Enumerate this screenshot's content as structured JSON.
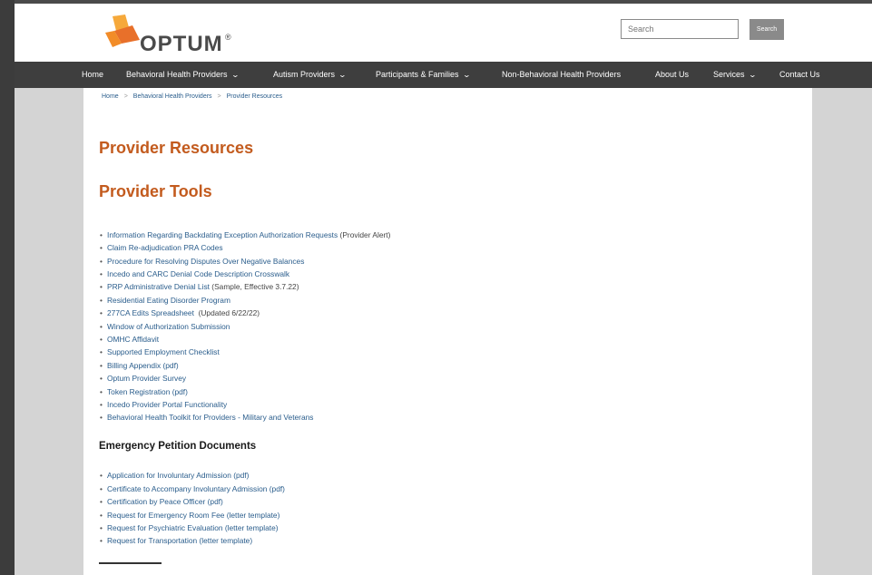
{
  "header": {
    "logo_text": "OPTUM",
    "logo_reg": "®",
    "search_placeholder": "Search",
    "search_button": "Search",
    "colors": {
      "logo_orange": "#F28C28",
      "logo_dark": "#4a4a4a"
    }
  },
  "nav": {
    "items": [
      {
        "label": "Home",
        "dropdown": false
      },
      {
        "label": "Behavioral Health Providers",
        "dropdown": true
      },
      {
        "label": "Autism Providers",
        "dropdown": true
      },
      {
        "label": "Participants & Families",
        "dropdown": true
      },
      {
        "label": "Non-Behavioral Health Providers",
        "dropdown": false
      },
      {
        "label": "About Us",
        "dropdown": false
      },
      {
        "label": "Services",
        "dropdown": true
      },
      {
        "label": "Contact Us",
        "dropdown": false
      }
    ]
  },
  "breadcrumb": [
    "Home",
    "Behavioral Health Providers",
    "Provider Resources"
  ],
  "page_title": "Provider Resources",
  "section_title": "Provider Tools",
  "tools": [
    {
      "link": "Information Regarding Backdating Exception Authorization Requests",
      "suffix": " (Provider Alert)"
    },
    {
      "link": "Claim Re-adjudication PRA Codes",
      "suffix": ""
    },
    {
      "link": "Procedure for Resolving Disputes Over Negative Balances",
      "suffix": ""
    },
    {
      "link": "Incedo and CARC Denial Code Description Crosswalk",
      "suffix": ""
    },
    {
      "link": "PRP Administrative Denial List",
      "suffix": " (Sample, Effective 3.7.22)"
    },
    {
      "link": "Residential Eating Disorder Program",
      "suffix": ""
    },
    {
      "link": "277CA Edits Spreadsheet",
      "suffix": "  (Updated 6/22/22)"
    },
    {
      "link": "Window of Authorization Submission",
      "suffix": ""
    },
    {
      "link": "OMHC Affidavit",
      "suffix": ""
    },
    {
      "link": "Supported Employment Checklist",
      "suffix": ""
    },
    {
      "link": "Billing Appendix (pdf)",
      "suffix": ""
    },
    {
      "link": "Optum Provider Survey",
      "suffix": ""
    },
    {
      "link": "Token Registration (pdf)",
      "suffix": ""
    },
    {
      "link": "Incedo Provider Portal Functionality",
      "suffix": ""
    },
    {
      "link": "Behavioral Health Toolkit for Providers - Military and Veterans",
      "suffix": ""
    }
  ],
  "emergency_title": "Emergency Petition Documents",
  "emergency": [
    {
      "link": "Application for Involuntary Admission (pdf)"
    },
    {
      "link": "Certificate to Accompany Involuntary Admission (pdf)"
    },
    {
      "link": "Certification by Peace Officer (pdf)"
    },
    {
      "link": "Request for Emergency Room Fee (letter template)"
    },
    {
      "link": "Request for Psychiatric Evaluation (letter template)"
    },
    {
      "link": "Request for Transportation (letter template)"
    }
  ]
}
